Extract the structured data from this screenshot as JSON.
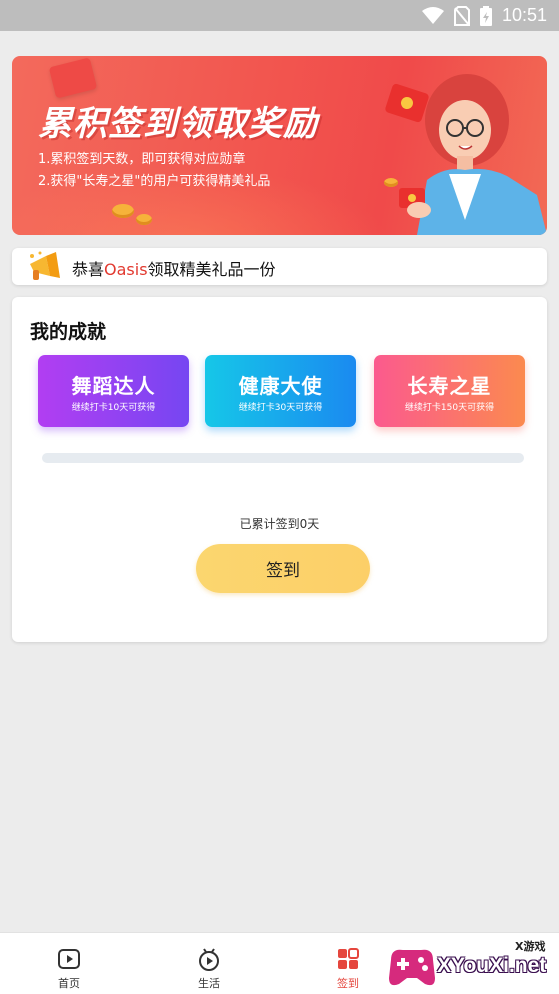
{
  "status_bar": {
    "time": "10:51",
    "icons": [
      "wifi-icon",
      "no-sim-icon",
      "battery-icon"
    ]
  },
  "banner": {
    "title": "累积签到领取奖励",
    "rule_1": "1.累积签到天数，即可获得对应勋章",
    "rule_2": "2.获得\"长寿之星\"的用户可获得精美礼品"
  },
  "announcement": {
    "prefix": "恭喜",
    "user": "Oasis",
    "suffix": "领取精美礼品一份",
    "icon": "megaphone-icon"
  },
  "achievements": {
    "title": "我的成就",
    "badges": [
      {
        "name": "舞蹈达人",
        "desc": "继续打卡10天可获得"
      },
      {
        "name": "健康大使",
        "desc": "继续打卡30天可获得"
      },
      {
        "name": "长寿之星",
        "desc": "继续打卡150天可获得"
      }
    ],
    "progress_fraction": 0,
    "count_text": "已累计签到0天",
    "checkin_label": "签到"
  },
  "bottom_nav": {
    "items": [
      {
        "label": "首页",
        "icon": "home-play-icon"
      },
      {
        "label": "生活",
        "icon": "life-play-icon"
      },
      {
        "label": "签到",
        "icon": "checkin-grid-icon",
        "active": true
      }
    ]
  },
  "watermark": {
    "site": "XYouXi.net",
    "tag": "X游戏"
  },
  "colors": {
    "accent": "#e5463d",
    "button": "#fcd36b",
    "highlight": "#e23a30"
  }
}
